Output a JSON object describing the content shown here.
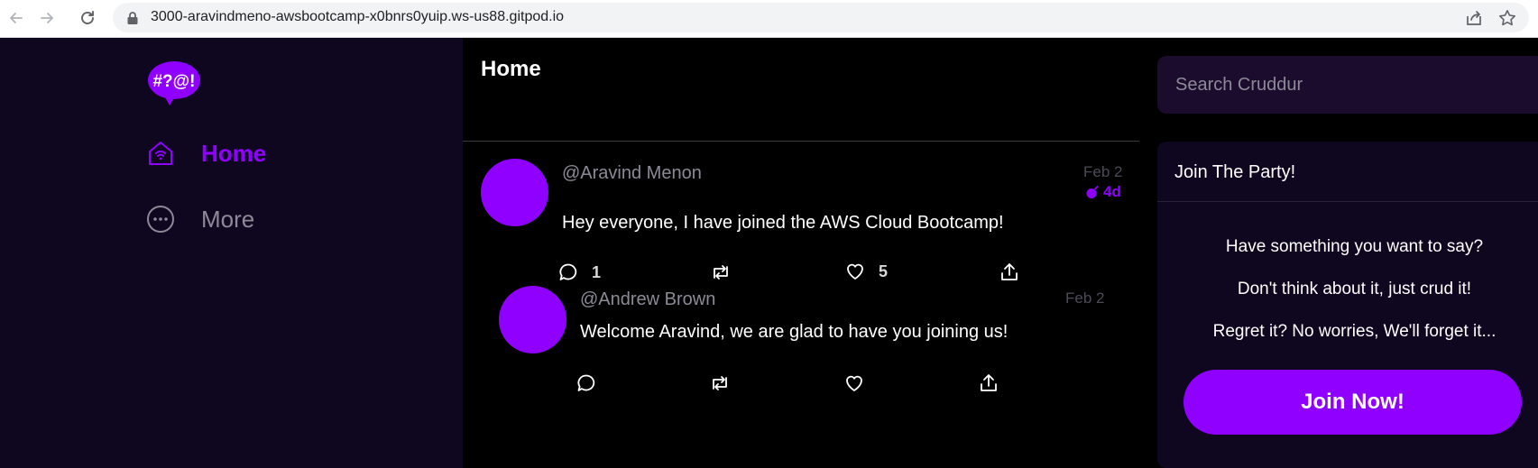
{
  "browser": {
    "url": "3000-aravindmeno-awsbootcamp-x0bnrs0yuip.ws-us88.gitpod.io"
  },
  "nav": {
    "logo_text": "#?@!",
    "items": [
      {
        "label": "Home",
        "icon": "home-icon",
        "active": true
      },
      {
        "label": "More",
        "icon": "more-icon",
        "active": false
      }
    ]
  },
  "feed": {
    "title": "Home",
    "activities": [
      {
        "handle": "@Aravind Menon",
        "message": "Hey everyone, I have joined the AWS Cloud Bootcamp!",
        "date": "Feb 2",
        "expires": "4d",
        "replies": "1",
        "reposts": "",
        "likes": "5"
      },
      {
        "handle": "@Andrew Brown",
        "message": "Welcome Aravind, we are glad to have you joining us!",
        "date": "Feb 2",
        "replies": "",
        "reposts": "",
        "likes": ""
      }
    ]
  },
  "sidebar": {
    "search_placeholder": "Search Cruddur",
    "join": {
      "title": "Join The Party!",
      "lines": [
        "Have something you want to say?",
        "Don't think about it, just crud it!",
        "Regret it? No worries, We'll forget it..."
      ],
      "button": "Join Now!"
    }
  },
  "colors": {
    "accent": "#8f00ff",
    "nav_bg": "#0f0620",
    "feed_bg": "#000000",
    "muted": "#8d8a97"
  }
}
